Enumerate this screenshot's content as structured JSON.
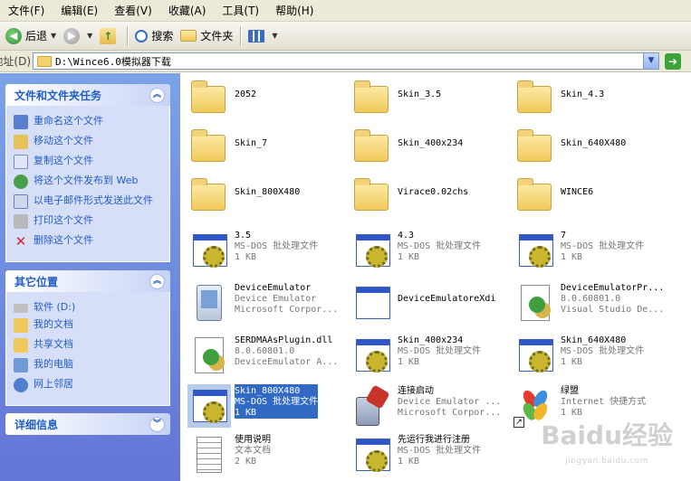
{
  "menu": [
    "文件(F)",
    "编辑(E)",
    "查看(V)",
    "收藏(A)",
    "工具(T)",
    "帮助(H)"
  ],
  "toolbar": {
    "back": "后退",
    "search": "搜索",
    "folders": "文件夹"
  },
  "address": {
    "label": "地址(D)",
    "path": "D:\\Wince6.0模拟器下载"
  },
  "taskpane": {
    "file_tasks": {
      "title": "文件和文件夹任务",
      "items": [
        {
          "label": "重命名这个文件",
          "icon": "rename-icon"
        },
        {
          "label": "移动这个文件",
          "icon": "move-icon"
        },
        {
          "label": "复制这个文件",
          "icon": "copy-icon"
        },
        {
          "label": "将这个文件发布到 Web",
          "icon": "publish-web-icon"
        },
        {
          "label": "以电子邮件形式发送此文件",
          "icon": "email-icon"
        },
        {
          "label": "打印这个文件",
          "icon": "print-icon"
        },
        {
          "label": "删除这个文件",
          "icon": "delete-icon"
        }
      ]
    },
    "other_places": {
      "title": "其它位置",
      "items": [
        {
          "label": "软件 (D:)",
          "icon": "drive-icon"
        },
        {
          "label": "我的文档",
          "icon": "my-documents-icon"
        },
        {
          "label": "共享文档",
          "icon": "shared-documents-icon"
        },
        {
          "label": "我的电脑",
          "icon": "my-computer-icon"
        },
        {
          "label": "网上邻居",
          "icon": "network-icon"
        }
      ]
    },
    "details": {
      "title": "详细信息"
    }
  },
  "files": [
    {
      "name": "2052",
      "type": "folder"
    },
    {
      "name": "Skin_3.5",
      "type": "folder"
    },
    {
      "name": "Skin_4.3",
      "type": "folder"
    },
    {
      "name": "Skin_7",
      "type": "folder"
    },
    {
      "name": "Skin_400x234",
      "type": "folder"
    },
    {
      "name": "Skin_640X480",
      "type": "folder"
    },
    {
      "name": "Skin_800X480",
      "type": "folder"
    },
    {
      "name": "Virace0.02chs",
      "type": "folder"
    },
    {
      "name": "WINCE6",
      "type": "folder"
    },
    {
      "name": "3.5",
      "type": "batch",
      "line2": "MS-DOS 批处理文件",
      "line3": "1 KB"
    },
    {
      "name": "4.3",
      "type": "batch",
      "line2": "MS-DOS 批处理文件",
      "line3": "1 KB"
    },
    {
      "name": "7",
      "type": "batch",
      "line2": "MS-DOS 批处理文件",
      "line3": "1 KB"
    },
    {
      "name": "DeviceEmulator",
      "type": "device",
      "line2": "Device Emulator",
      "line3": "Microsoft Corpor..."
    },
    {
      "name": "DeviceEmulatoreXdi",
      "type": "window"
    },
    {
      "name": "DeviceEmulatorPr...",
      "type": "dll",
      "line2": "8.0.60801.0",
      "line3": "Visual Studio De..."
    },
    {
      "name": "SERDMAAsPlugin.dll",
      "type": "dll",
      "line2": "8.0.60801.0",
      "line3": "DeviceEmulator A..."
    },
    {
      "name": "Skin_400x234",
      "type": "batch",
      "line2": "MS-DOS 批处理文件",
      "line3": "1 KB"
    },
    {
      "name": "Skin_640X480",
      "type": "batch",
      "line2": "MS-DOS 批处理文件",
      "line3": "1 KB"
    },
    {
      "name": "Skin_800X480",
      "type": "batch",
      "line2": "MS-DOS 批处理文件",
      "line3": "1 KB",
      "selected": true
    },
    {
      "name": "连接启动",
      "type": "connect",
      "line2": "Device Emulator ...",
      "line3": "Microsoft Corpor..."
    },
    {
      "name": "绿盟",
      "type": "msn",
      "line2": "Internet 快捷方式",
      "line3": "1 KB"
    },
    {
      "name": "使用说明",
      "type": "text",
      "line2": "文本文档",
      "line3": "2 KB"
    },
    {
      "name": "先运行我进行注册",
      "type": "batch",
      "line2": "MS-DOS 批处理文件",
      "line3": "1 KB"
    }
  ],
  "watermark": {
    "brand": "Baidu经验",
    "url": "jingyan.baidu.com"
  }
}
